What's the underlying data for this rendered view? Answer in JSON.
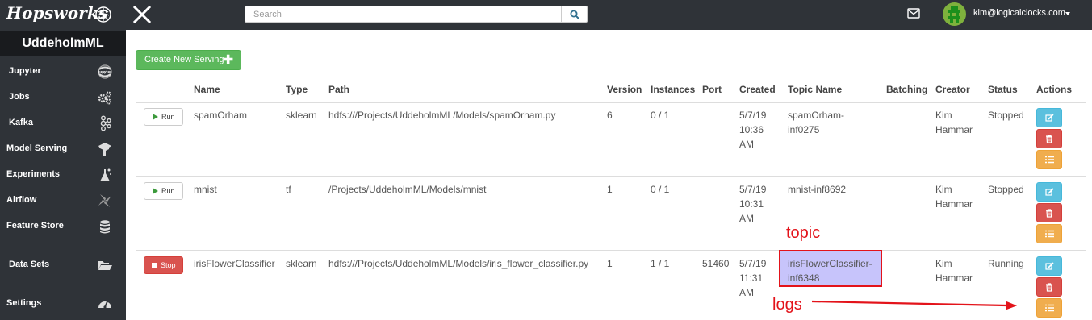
{
  "app": {
    "brand": "Hopsworks"
  },
  "topbar": {
    "search_placeholder": "Search",
    "user_email": "kim@logicalclocks.com"
  },
  "sidebar": {
    "project_name": "UddeholmML",
    "items": [
      {
        "label": "Jupyter",
        "icon": "jupyter-icon"
      },
      {
        "label": "Jobs",
        "icon": "gears-icon"
      },
      {
        "label": "Kafka",
        "icon": "kafka-icon"
      },
      {
        "label": "Model Serving",
        "icon": "model-serving-icon"
      },
      {
        "label": "Experiments",
        "icon": "experiments-icon"
      },
      {
        "label": "Airflow",
        "icon": "airflow-icon"
      },
      {
        "label": "Feature Store",
        "icon": "database-icon"
      },
      {
        "label": "Data Sets",
        "icon": "folder-open-icon"
      },
      {
        "label": "Settings",
        "icon": "dashboard-icon"
      }
    ]
  },
  "main": {
    "create_button": "Create New Serving",
    "columns": [
      "Name",
      "Type",
      "Path",
      "Version",
      "Instances",
      "Port",
      "Created",
      "Topic Name",
      "Batching",
      "Creator",
      "Status",
      "Actions"
    ],
    "rows": [
      {
        "control": "Run",
        "name": "spamOrham",
        "type": "sklearn",
        "path": "hdfs:///Projects/UddeholmML/Models/spamOrham.py",
        "version": "6",
        "instances": "0 / 1",
        "port": "",
        "created_date": "5/7/19",
        "created_time": "10:36",
        "created_ampm": "AM",
        "topic_a": "spamOrham-",
        "topic_b": "inf0275",
        "batching": "",
        "creator_first": "Kim",
        "creator_last": "Hammar",
        "status": "Stopped"
      },
      {
        "control": "Run",
        "name": "mnist",
        "type": "tf",
        "path": "/Projects/UddeholmML/Models/mnist",
        "version": "1",
        "instances": "0 / 1",
        "port": "",
        "created_date": "5/7/19",
        "created_time": "10:31",
        "created_ampm": "AM",
        "topic_a": "mnist-inf8692",
        "topic_b": "",
        "batching": "",
        "creator_first": "Kim",
        "creator_last": "Hammar",
        "status": "Stopped"
      },
      {
        "control": "Stop",
        "name": "irisFlowerClassifier",
        "type": "sklearn",
        "path": "hdfs:///Projects/UddeholmML/Models/iris_flower_classifier.py",
        "version": "1",
        "instances": "1 / 1",
        "port": "51460",
        "created_date": "5/7/19",
        "created_time": "11:31",
        "created_ampm": "AM",
        "topic_a": "irisFlowerClassifier-",
        "topic_b": "inf6348",
        "batching": "",
        "creator_first": "Kim",
        "creator_last": "Hammar",
        "status": "Running"
      }
    ]
  },
  "annotations": {
    "topic_label": "topic",
    "logs_label": "logs",
    "color": "#e3131a",
    "highlight_fill": "#c7c4fb"
  },
  "colors": {
    "navbar": "#2f3338",
    "success": "#5cb85c",
    "danger": "#d9534f",
    "info": "#5bc0de",
    "warning": "#f0ad4e"
  }
}
